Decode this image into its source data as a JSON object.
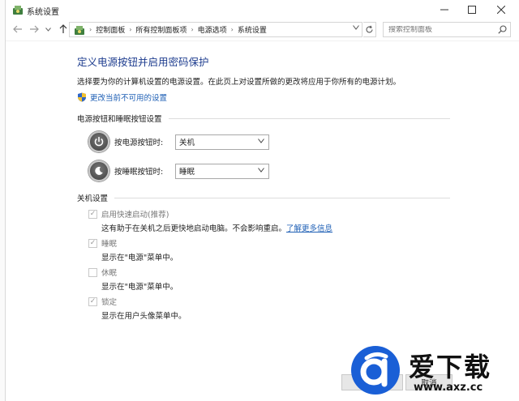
{
  "window": {
    "title": "系统设置"
  },
  "address_bar": {
    "breadcrumbs": [
      "控制面板",
      "所有控制面板项",
      "电源选项",
      "系统设置"
    ],
    "search_placeholder": "搜索控制面板"
  },
  "page": {
    "title": "定义电源按钮并启用密码保护",
    "subtitle": "选择要为你的计算机设置的电源设置。在此页上对设置所做的更改将应用于你所有的电源计划。",
    "change_unavailable_link": "更改当前不可用的设置"
  },
  "power_buttons_section": {
    "heading": "电源按钮和睡眠按钮设置",
    "rows": [
      {
        "label": "按电源按钮时:",
        "value": "关机",
        "icon": "power-icon"
      },
      {
        "label": "按睡眠按钮时:",
        "value": "睡眠",
        "icon": "sleep-icon"
      }
    ]
  },
  "shutdown_section": {
    "heading": "关机设置",
    "options": [
      {
        "label": "启用快速启动(推荐)",
        "description": "这有助于在关机之后更快地启动电脑。不会影响重启。",
        "link": "了解更多信息",
        "checked": true
      },
      {
        "label": "睡眠",
        "description": "显示在\"电源\"菜单中。",
        "checked": true
      },
      {
        "label": "休眠",
        "description": "显示在\"电源\"菜单中。",
        "checked": false
      },
      {
        "label": "锁定",
        "description": "显示在用户头像菜单中。",
        "checked": true
      }
    ]
  },
  "footer": {
    "save_label": "保存修改",
    "cancel_label": "取消"
  },
  "watermark": {
    "text": "爱下载",
    "url": "www.axz.cc"
  },
  "colors": {
    "title_blue": "#1e3d8f",
    "link_blue": "#1e5fb5",
    "watermark_blue": "#1a5fd6"
  }
}
